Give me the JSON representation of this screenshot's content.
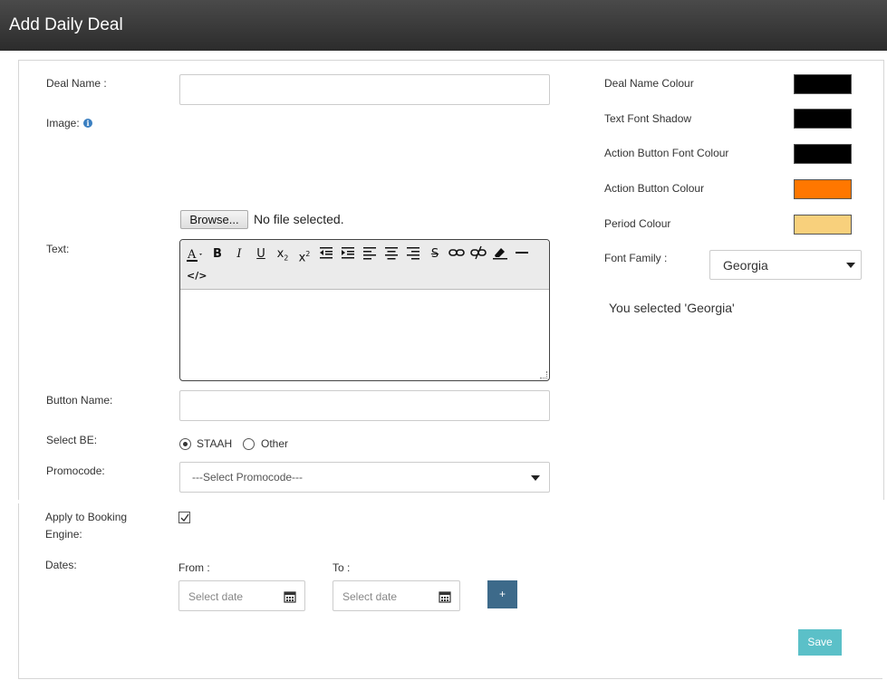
{
  "header": {
    "title": "Add Daily Deal"
  },
  "form": {
    "deal_name_label": "Deal Name :",
    "deal_name_value": "",
    "image_label": "Image:",
    "browse_label": "Browse...",
    "file_status": "No file selected.",
    "text_label": "Text:",
    "button_name_label": "Button Name:",
    "button_name_value": "",
    "select_be_label": "Select BE:",
    "be_options": [
      {
        "label": "STAAH",
        "checked": true
      },
      {
        "label": "Other",
        "checked": false
      }
    ],
    "promocode_label": "Promocode:",
    "promocode_selected": "---Select Promocode---",
    "apply_label_line1": "Apply to Booking",
    "apply_label_line2": "Engine:",
    "apply_checked": true,
    "dates_label": "Dates:",
    "from_label": "From :",
    "to_label": "To :",
    "from_placeholder": "Select  date",
    "to_placeholder": "Select  date",
    "add_date_label": "+",
    "save_label": "Save"
  },
  "editor": {
    "toolbar": [
      "font-color-icon",
      "bold-icon",
      "italic-icon",
      "underline-icon",
      "subscript-icon",
      "superscript-icon",
      "outdent-icon",
      "indent-icon",
      "align-left-icon",
      "align-center-icon",
      "align-right-icon",
      "strikethrough-icon",
      "link-icon",
      "unlink-icon",
      "eraser-icon",
      "horizontal-rule-icon",
      "code-view-icon"
    ],
    "content": ""
  },
  "style_settings": {
    "deal_name_colour_label": "Deal Name Colour",
    "deal_name_colour": "#000000",
    "text_font_shadow_label": "Text Font Shadow",
    "text_font_shadow": "#000000",
    "action_button_font_colour_label": "Action Button Font Colour",
    "action_button_font_colour": "#000000",
    "action_button_colour_label": "Action Button Colour",
    "action_button_colour": "#ff7700",
    "period_colour_label": "Period Colour",
    "period_colour": "#f8d07c",
    "font_family_label": "Font Family :",
    "font_family_selected": "Georgia",
    "selected_message": "You selected 'Georgia'"
  },
  "colors": {
    "header_bg": "#333333",
    "save_button": "#5bc0c8",
    "add_button": "#3d6a8a"
  }
}
